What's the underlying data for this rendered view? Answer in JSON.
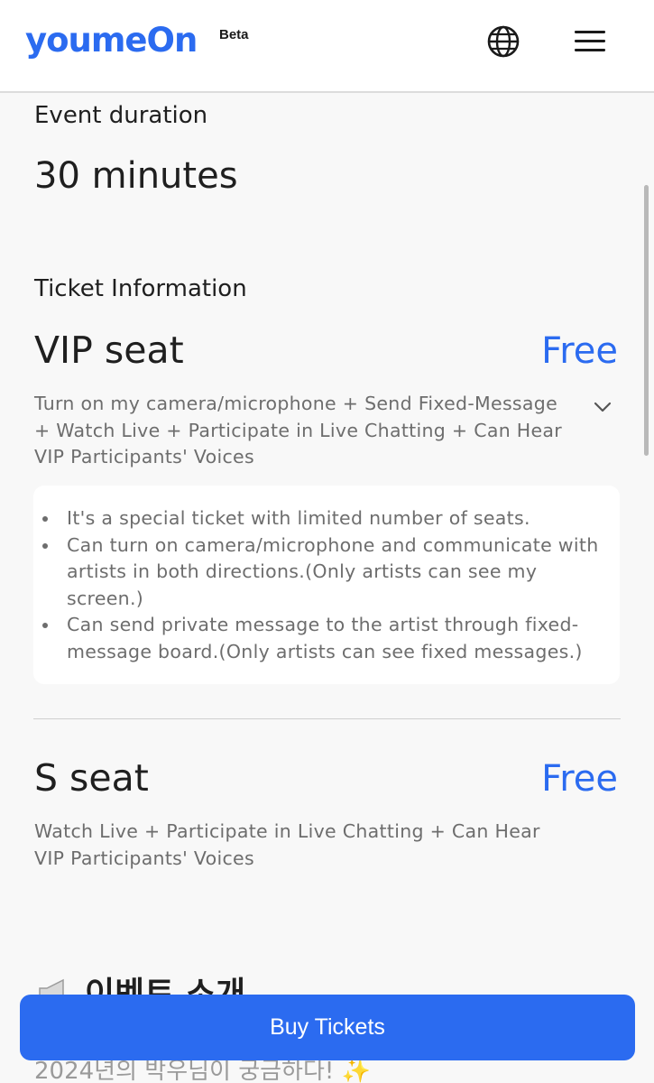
{
  "header": {
    "logo_text": "youmeOn",
    "beta_label": "Beta",
    "icons": {
      "language": "globe-icon",
      "menu": "hamburger-menu-icon"
    }
  },
  "event_duration": {
    "label": "Event duration",
    "value": "30 minutes"
  },
  "ticket_info": {
    "label": "Ticket Information",
    "seats": [
      {
        "name": "VIP seat",
        "price": "Free",
        "description": "Turn on my camera/microphone + Send Fixed-Message + Watch Live + Participate in Live Chatting + Can Hear VIP Participants' Voices",
        "expanded": true,
        "details": [
          "It's a special ticket with limited number of seats.",
          "Can turn on camera/microphone and communicate with artists in both directions.(Only artists can see my screen.)",
          "Can send private message to the artist through fixed-message board.(Only artists can see fixed messages.)"
        ]
      },
      {
        "name": "S seat",
        "price": "Free",
        "description": "Watch Live + Participate in Live Chatting + Can Hear VIP Participants' Voices"
      }
    ]
  },
  "intro": {
    "heading": "이벤트 소개",
    "line1": "2024년의 박우님이 궁금하다! ✨"
  },
  "buy_button_label": "Buy Tickets",
  "colors": {
    "accent": "#2b6bf0",
    "muted_text": "#6d6d6d",
    "background": "#f8f8f8"
  }
}
